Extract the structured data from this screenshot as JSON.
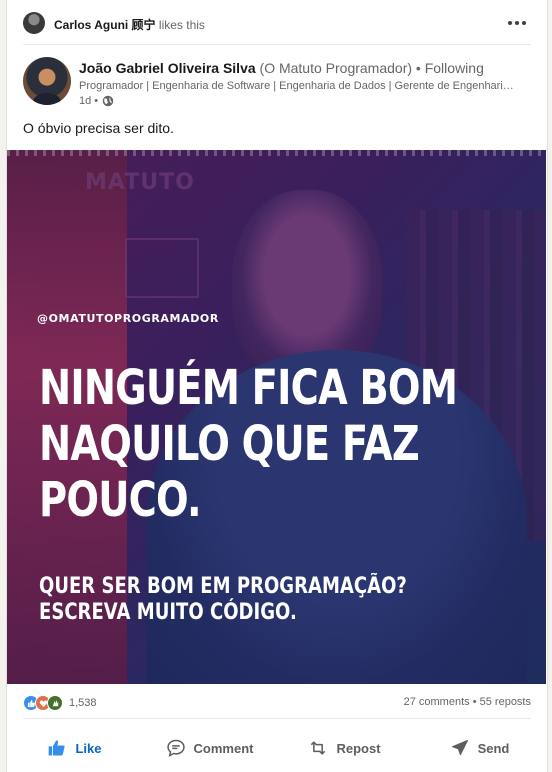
{
  "social_context": {
    "liker_name": "Carlos Aguni 顾宁",
    "liker_action": "likes this"
  },
  "author": {
    "name": "João Gabriel Oliveira Silva",
    "alias": "(O Matuto Programador)",
    "separator": "•",
    "follow_state": "Following",
    "headline": "Programador | Engenharia de Software | Engenharia de Dados | Gerente de Engenharia de Software",
    "time": "1d •"
  },
  "post": {
    "text": "O óbvio precisa ser dito.",
    "image": {
      "brand_text": "MATUTO",
      "handle": "@OMATUTOPROGRAMADOR",
      "headline_lines": [
        "NINGUÉM FICA BOM",
        "NAQUILO QUE FAZ",
        "POUCO."
      ],
      "sub_lines": [
        "QUER SER BOM EM PROGRAMAÇÃO?",
        "ESCREVA MUITO CÓDIGO."
      ]
    }
  },
  "engagement": {
    "reaction_count": "1,538",
    "comments": "27 comments",
    "dot": "•",
    "reposts": "55 reposts",
    "reaction_icons": [
      "like-reaction-icon",
      "love-reaction-icon",
      "celebrate-reaction-icon"
    ]
  },
  "actions": {
    "like": "Like",
    "comment": "Comment",
    "repost": "Repost",
    "send": "Send"
  },
  "colors": {
    "brand_blue": "#0a66c2",
    "like_reaction": "#378fe9",
    "love_reaction": "#df704d",
    "celebrate_reaction": "#44712e"
  }
}
